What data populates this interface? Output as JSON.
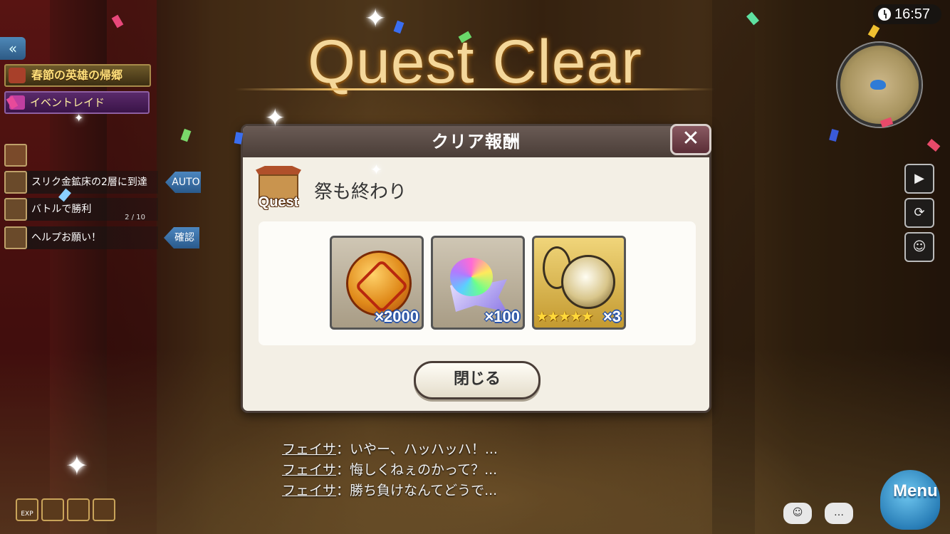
{
  "banner": {
    "title": "Quest Clear"
  },
  "clock": {
    "time": "16:57"
  },
  "left_panel": {
    "event_banner": "春節の英雄の帰郷",
    "raid_tab": "イベントレイド",
    "quest_tag": "Quest",
    "missions": [
      {
        "text": "スリク金鉱床の2層に到達",
        "action": "AUTO",
        "progress": ""
      },
      {
        "text": "バトルで勝利",
        "action": "",
        "progress": "2 / 10"
      },
      {
        "text": "ヘルプお願い！",
        "action": "確認",
        "progress": ""
      }
    ],
    "bottom_icons": [
      "EXP",
      "",
      "",
      ""
    ]
  },
  "right_panel": {
    "buttons": [
      "camera-icon",
      "auto-icon",
      "party-icon"
    ],
    "menu_label": "Menu"
  },
  "dialogue": [
    {
      "speaker": "フェイサ",
      "line": "：いやー、ハッハッハ！..."
    },
    {
      "speaker": "フェイサ",
      "line": "：悔しくねぇのかって？..."
    },
    {
      "speaker": "フェイサ",
      "line": "：勝ち負けなんてどうで..."
    }
  ],
  "modal": {
    "title": "クリア報酬",
    "close_glyph": "✕",
    "quest_icon_label": "Quest",
    "quest_name": "祭も終わり",
    "rewards": [
      {
        "name": "festival-coin",
        "quantity": "×2000",
        "stars": ""
      },
      {
        "name": "rainbow-crystal",
        "quantity": "×100",
        "stars": ""
      },
      {
        "name": "golden-ornament",
        "quantity": "×3",
        "stars": "★★★★★"
      }
    ],
    "close_button": "閉じる"
  },
  "colors": {
    "modal_header": "#4a3d37",
    "modal_body": "#f3efe5",
    "title_gold": "#f4d79a",
    "qty_outline": "#2a55a8"
  }
}
